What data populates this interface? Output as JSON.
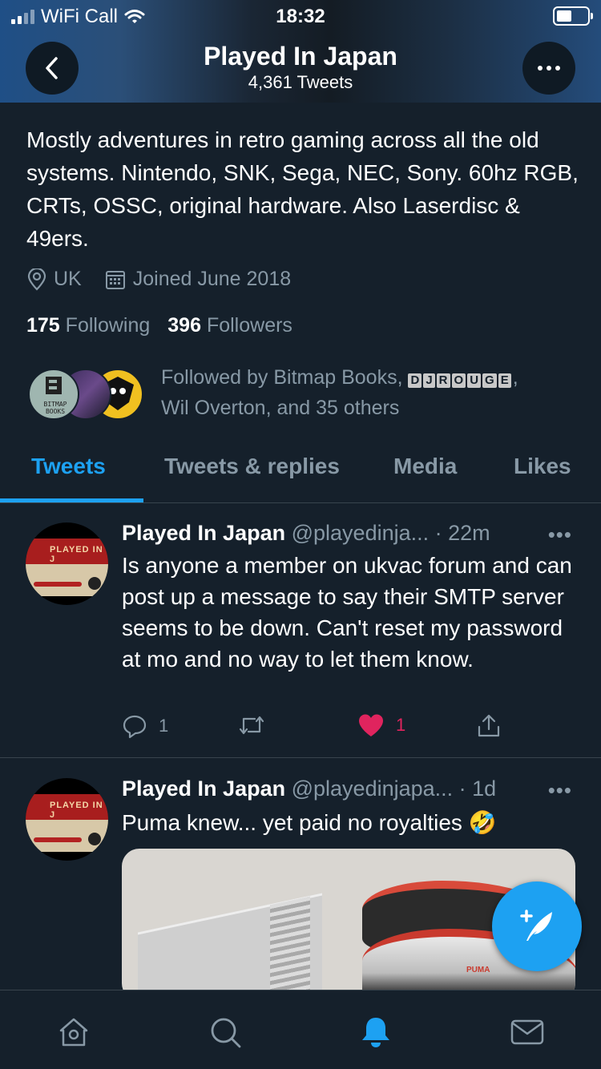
{
  "status_bar": {
    "carrier": "WiFi Call",
    "time": "18:32"
  },
  "header": {
    "title": "Played In Japan",
    "subtitle": "4,361 Tweets"
  },
  "profile": {
    "bio": "Mostly adventures in retro gaming across all the old systems. Nintendo, SNK, Sega, NEC, Sony. 60hz RGB, CRTs, OSSC, original hardware. Also Laserdisc & 49ers.",
    "location": "UK",
    "joined": "Joined June 2018",
    "following_count": "175",
    "following_label": "Following",
    "followers_count": "396",
    "followers_label": "Followers",
    "followed_by_prefix": "Followed by Bitmap Books,",
    "followed_by_tags": [
      "D",
      "J",
      "R",
      "O",
      "U",
      "G",
      "E"
    ],
    "followed_by_suffix": "Wil Overton, and 35 others",
    "avatar_bitmap_text": "BITMAP BOOKS"
  },
  "tabs": [
    {
      "label": "Tweets",
      "active": true
    },
    {
      "label": "Tweets & replies",
      "active": false
    },
    {
      "label": "Media",
      "active": false
    },
    {
      "label": "Likes",
      "active": false
    }
  ],
  "tweets": [
    {
      "author": "Played In Japan",
      "handle": "@playedinja...",
      "time": "· 22m",
      "text": "Is anyone a member on ukvac forum and can post up a message to say their SMTP server seems to be down. Can't reset my password at mo and no way to let them know.",
      "replies": "1",
      "likes": "1",
      "avatar_label": "PLAYED IN J"
    },
    {
      "author": "Played In Japan",
      "handle": "@playedinjapa...",
      "time": "· 1d",
      "text": "Puma knew... yet paid no royalties 🤣",
      "avatar_label": "PLAYED IN J",
      "media_brand": "PUMA"
    }
  ],
  "colors": {
    "background": "#15202b",
    "accent": "#1da1f2",
    "like": "#e0245e",
    "muted": "#8899a6"
  },
  "icons": [
    "signal-icon",
    "wifi-icon",
    "battery-icon",
    "back-arrow-icon",
    "more-icon",
    "location-pin-icon",
    "calendar-icon",
    "reply-icon",
    "retweet-icon",
    "heart-icon",
    "share-icon",
    "compose-tweet-icon",
    "home-icon",
    "search-icon",
    "notifications-bell-icon",
    "messages-envelope-icon"
  ]
}
